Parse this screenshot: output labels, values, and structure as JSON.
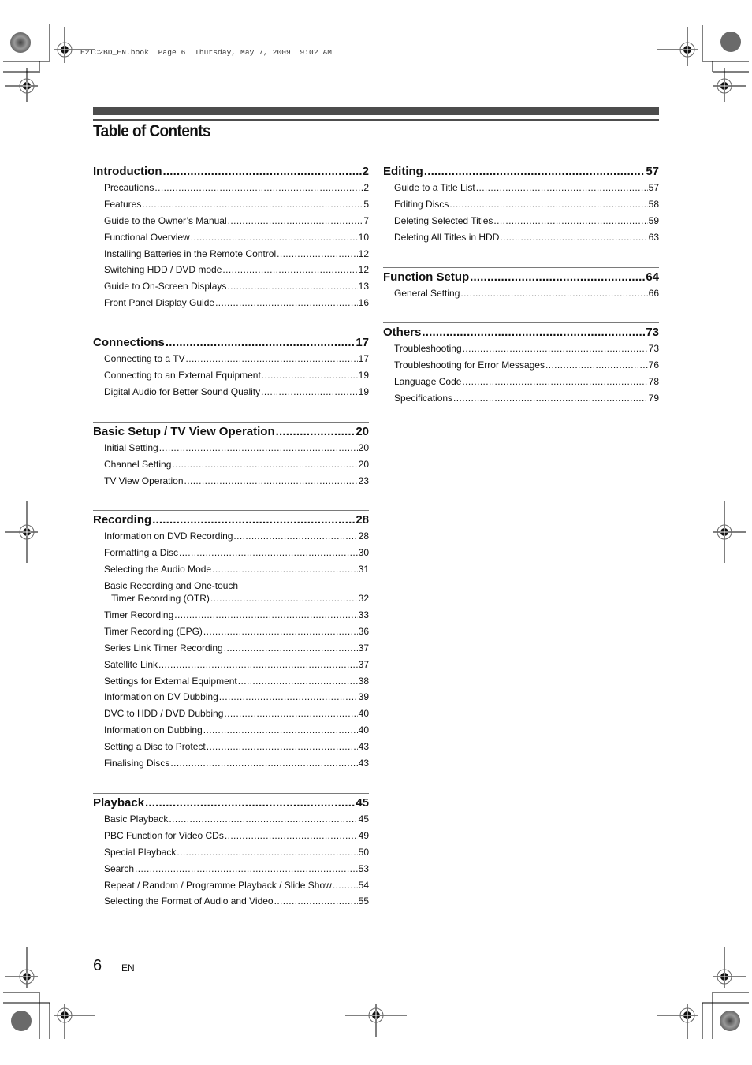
{
  "print_header": "E2TC2BD_EN.book  Page 6  Thursday, May 7, 2009  9:02 AM",
  "page_title": "Table of Contents",
  "footer": {
    "page_number": "6",
    "language": "EN"
  },
  "left_column": [
    {
      "title": "Introduction",
      "page": "2",
      "items": [
        {
          "label": "Precautions",
          "page": "2"
        },
        {
          "label": "Features",
          "page": "5"
        },
        {
          "label": "Guide to the Owner’s Manual",
          "page": "7"
        },
        {
          "label": "Functional Overview",
          "page": "10"
        },
        {
          "label": "Installing Batteries in the Remote Control",
          "page": "12"
        },
        {
          "label": "Switching HDD / DVD mode",
          "page": "12"
        },
        {
          "label": "Guide to On-Screen Displays",
          "page": "13"
        },
        {
          "label": "Front Panel Display Guide",
          "page": "16"
        }
      ]
    },
    {
      "title": "Connections",
      "page": "17",
      "items": [
        {
          "label": "Connecting to a TV",
          "page": "17"
        },
        {
          "label": "Connecting to an External Equipment",
          "page": "19"
        },
        {
          "label": "Digital Audio for Better Sound Quality",
          "page": "19"
        }
      ]
    },
    {
      "title": "Basic Setup / TV View Operation",
      "page": "20",
      "items": [
        {
          "label": "Initial Setting",
          "page": "20"
        },
        {
          "label": "Channel Setting",
          "page": "20"
        },
        {
          "label": "TV View Operation",
          "page": "23"
        }
      ]
    },
    {
      "title": "Recording",
      "page": "28",
      "items": [
        {
          "label": "Information on DVD Recording",
          "page": "28"
        },
        {
          "label": "Formatting a Disc",
          "page": "30"
        },
        {
          "label": "Selecting the Audio Mode",
          "page": "31"
        },
        {
          "label": "Basic Recording and One-touch",
          "label2": "Timer Recording (OTR)",
          "page": "32"
        },
        {
          "label": "Timer Recording",
          "page": "33"
        },
        {
          "label": "Timer Recording (EPG)",
          "page": "36"
        },
        {
          "label": "Series Link Timer Recording",
          "page": "37"
        },
        {
          "label": "Satellite Link",
          "page": "37"
        },
        {
          "label": "Settings for External Equipment",
          "page": "38"
        },
        {
          "label": "Information on DV Dubbing",
          "page": "39"
        },
        {
          "label": "DVC to HDD / DVD Dubbing",
          "page": "40"
        },
        {
          "label": "Information on Dubbing",
          "page": "40"
        },
        {
          "label": "Setting a Disc to Protect",
          "page": "43"
        },
        {
          "label": "Finalising Discs",
          "page": "43"
        }
      ]
    },
    {
      "title": "Playback",
      "page": "45",
      "items": [
        {
          "label": "Basic Playback",
          "page": "45"
        },
        {
          "label": "PBC Function for Video CDs",
          "page": "49"
        },
        {
          "label": "Special Playback",
          "page": "50"
        },
        {
          "label": "Search",
          "page": "53"
        },
        {
          "label": "Repeat / Random / Programme Playback / Slide Show",
          "page": "54"
        },
        {
          "label": "Selecting the Format of Audio and Video",
          "page": "55"
        }
      ]
    }
  ],
  "right_column": [
    {
      "title": "Editing",
      "page": "57",
      "items": [
        {
          "label": "Guide to a Title List",
          "page": "57"
        },
        {
          "label": "Editing Discs",
          "page": "58"
        },
        {
          "label": "Deleting Selected Titles",
          "page": "59"
        },
        {
          "label": "Deleting All Titles in HDD",
          "page": "63"
        }
      ]
    },
    {
      "title": "Function Setup",
      "page": "64",
      "items": [
        {
          "label": "General Setting",
          "page": "66"
        }
      ]
    },
    {
      "title": "Others",
      "page": "73",
      "items": [
        {
          "label": "Troubleshooting",
          "page": "73"
        },
        {
          "label": "Troubleshooting for Error Messages",
          "page": "76"
        },
        {
          "label": "Language Code",
          "page": "78"
        },
        {
          "label": "Specifications",
          "page": "79"
        }
      ]
    }
  ]
}
